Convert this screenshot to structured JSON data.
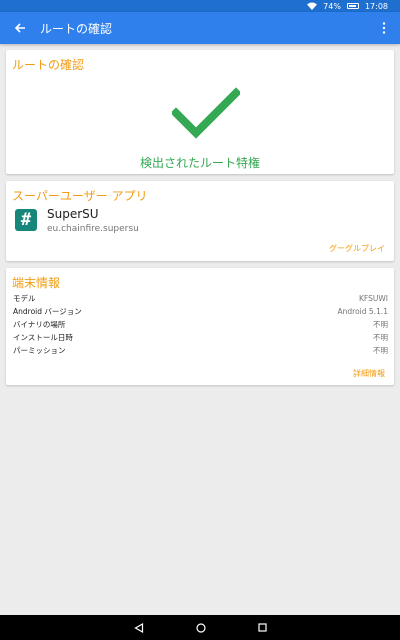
{
  "status_bar": {
    "battery": "74%",
    "time": "17:08",
    "icons": [
      "wifi-icon",
      "battery-icon"
    ]
  },
  "app_bar": {
    "title": "ルートの確認",
    "back_icon": "arrow-left-icon",
    "more_icon": "more-vertical-icon"
  },
  "root_card": {
    "title": "ルートの確認",
    "status_icon": "check-icon",
    "status_text": "検出されたルート特権",
    "status_color": "#34a853"
  },
  "su_card": {
    "title": "スーパーユーザー アプリ",
    "app_name": "SuperSU",
    "package": "eu.chainfire.supersu",
    "icon_glyph": "#",
    "icon_color": "#16877a",
    "link": "グーグルプレイ"
  },
  "device_card": {
    "title": "端末情報",
    "rows": [
      {
        "label": "モデル",
        "value": "KFSUWI"
      },
      {
        "label": "Android バージョン",
        "value": "Android 5.1.1"
      },
      {
        "label": "バイナリの場所",
        "value": "不明"
      },
      {
        "label": "インストール日時",
        "value": "不明"
      },
      {
        "label": "パーミッション",
        "value": "不明"
      }
    ],
    "link": "詳細情報"
  },
  "nav_bar": {
    "icons": [
      "back-triangle-icon",
      "home-circle-icon",
      "recents-square-icon"
    ]
  },
  "colors": {
    "app_bar": "#2f80ed",
    "status_bar": "#1e6fd0",
    "accent": "#f39c12",
    "success": "#34a853"
  }
}
